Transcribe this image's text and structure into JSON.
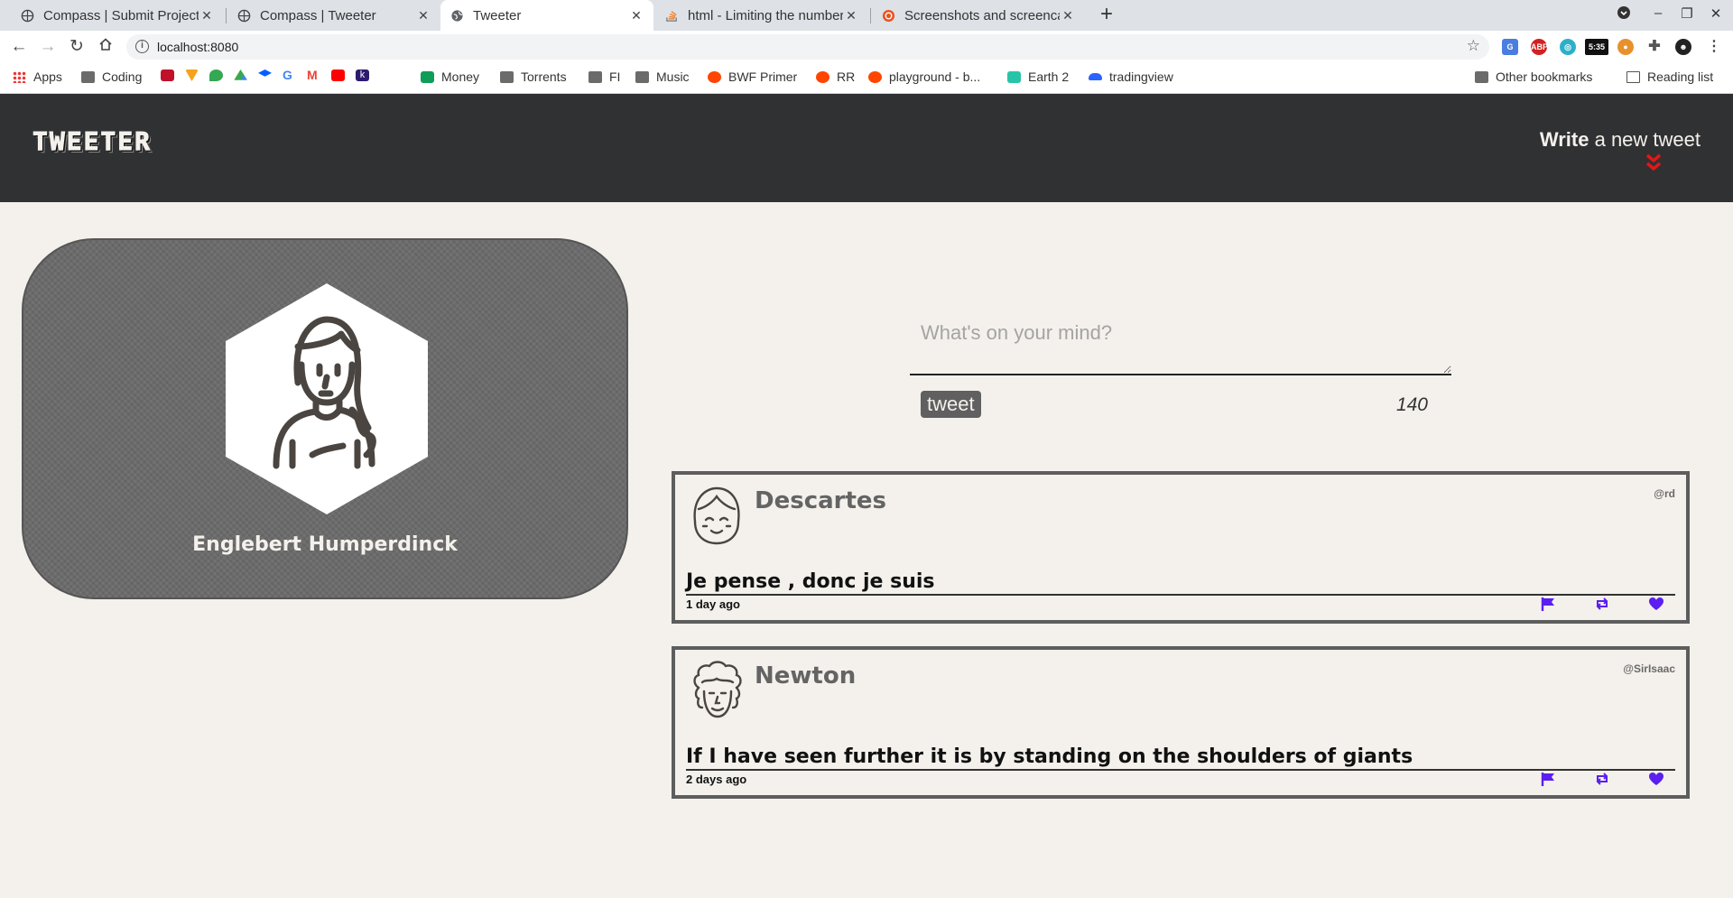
{
  "browser": {
    "tabs": [
      {
        "title": "Compass | Submit Project",
        "icon": "globe-icon"
      },
      {
        "title": "Compass | Tweeter",
        "icon": "globe-icon"
      },
      {
        "title": "Tweeter",
        "icon": "globe-icon"
      },
      {
        "title": "html - Limiting the number",
        "icon": "stackoverflow-icon"
      },
      {
        "title": "Screenshots and screencasts",
        "icon": "ubuntu-icon"
      }
    ],
    "url": "localhost:8080",
    "ext_time": "5:35",
    "ext_abp": "ABP",
    "bookmarks": [
      {
        "label": "Apps",
        "kind": "apps"
      },
      {
        "label": "Coding",
        "kind": "folder"
      },
      {
        "label": "Money",
        "kind": "sheet"
      },
      {
        "label": "Torrents",
        "kind": "folder"
      },
      {
        "label": "FI",
        "kind": "folder"
      },
      {
        "label": "Music",
        "kind": "folder"
      },
      {
        "label": "BWF Primer",
        "kind": "reddit"
      },
      {
        "label": "RR",
        "kind": "reddit"
      },
      {
        "label": "playground - b...",
        "kind": "reddit"
      },
      {
        "label": "Earth 2",
        "kind": "earth"
      },
      {
        "label": "tradingview",
        "kind": "cloud"
      }
    ],
    "other_bookmarks": "Other bookmarks",
    "reading_list": "Reading list"
  },
  "app": {
    "logo": "TWEETER",
    "write_bold": "Write",
    "write_rest": " a new tweet",
    "accent": "#e01818"
  },
  "profile": {
    "name": "Englebert Humperdinck"
  },
  "composer": {
    "placeholder": "What's on your mind?",
    "button_label": "tweet",
    "counter": "140"
  },
  "tweets": [
    {
      "name": "Descartes",
      "handle": "@rd",
      "content": "Je pense , donc je suis",
      "ago": "1 day ago"
    },
    {
      "name": "Newton",
      "handle": "@SirIsaac",
      "content": "If I have seen further it is by standing on the shoulders of giants",
      "ago": "2 days ago"
    }
  ],
  "colors": {
    "background": "#f4f1ec",
    "nav": "#303133",
    "action_purple": "#5b1ff0"
  }
}
